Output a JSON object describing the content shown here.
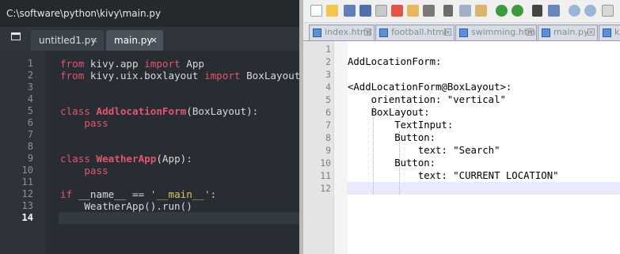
{
  "left_editor": {
    "title": "C:\\software\\python\\kivy\\main.py",
    "tabs": [
      {
        "label": "untitled1.py",
        "close": "×"
      },
      {
        "label": "main.py",
        "close": "×"
      }
    ],
    "line_numbers": [
      "1",
      "2",
      "3",
      "4",
      "5",
      "6",
      "7",
      "8",
      "9",
      "10",
      "11",
      "12",
      "13",
      "14"
    ],
    "lines": {
      "l1": {
        "kw1": "from",
        "mod": " kivy.app ",
        "kw2": "import",
        "rest": " App"
      },
      "l2": {
        "kw1": "from",
        "mod": " kivy.uix.boxlayout ",
        "kw2": "import",
        "rest": " BoxLayout"
      },
      "l5": {
        "kw": "class",
        "name": " AddlocationForm",
        "rest": "(BoxLayout):"
      },
      "l6": {
        "kw": "    pass"
      },
      "l9": {
        "kw": "class",
        "name": " WeatherApp",
        "rest": "(App):"
      },
      "l10": {
        "kw": "    pass"
      },
      "l12": {
        "kw": "if",
        "mid": " __name__ == ",
        "str": "'__main__'",
        "end": ":"
      },
      "l13": {
        "text": "    WeatherApp().run()"
      }
    }
  },
  "right_editor": {
    "file_tabs": [
      "index.html",
      "football.html",
      "swimming.html",
      "main.py",
      "ki"
    ],
    "line_numbers": [
      "1",
      "2",
      "3",
      "4",
      "5",
      "6",
      "7",
      "8",
      "9",
      "10",
      "11",
      "12"
    ],
    "lines": [
      "",
      "AddLocationForm:",
      "",
      "<AddLocationForm@BoxLayout>:",
      "    orientation: \"vertical\"",
      "    BoxLayout:",
      "        TextInput:",
      "        Button:",
      "            text: \"Search\"",
      "        Button:",
      "            text: \"CURRENT LOCATION\"",
      ""
    ]
  }
}
